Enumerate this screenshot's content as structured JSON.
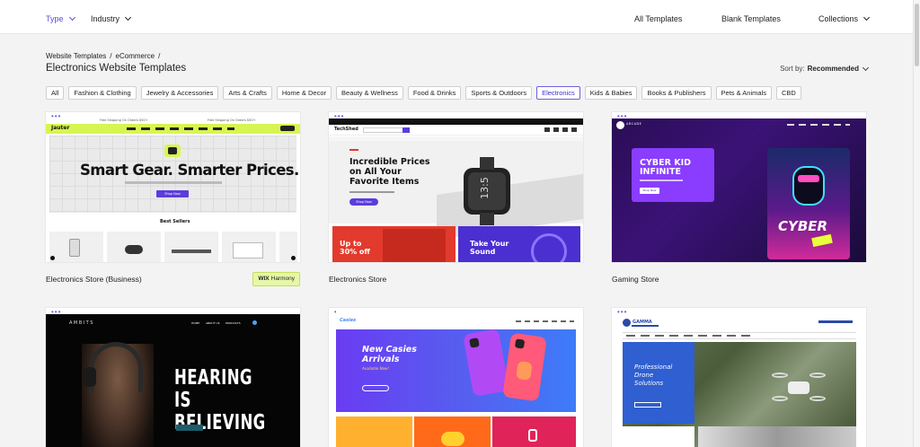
{
  "nav": {
    "type": "Type",
    "industry": "Industry",
    "all_templates": "All Templates",
    "blank_templates": "Blank Templates",
    "collections": "Collections"
  },
  "breadcrumb": [
    "Website Templates",
    "/",
    "eCommerce",
    "/"
  ],
  "page_title": "Electronics Website Templates",
  "sort": {
    "label": "Sort by:",
    "value": "Recommended"
  },
  "chips": [
    "All",
    "Fashion & Clothing",
    "Jewelry & Accessories",
    "Arts & Crafts",
    "Home & Decor",
    "Beauty & Wellness",
    "Food & Drinks",
    "Sports & Outdoors",
    "Electronics",
    "Kids & Babies",
    "Books & Publishers",
    "Pets & Animals",
    "CBD"
  ],
  "active_chip": "Electronics",
  "cards": [
    {
      "title": "Electronics Store (Business)",
      "badge_brand": "WIX",
      "badge_text": "Harmony",
      "preview": {
        "banner": "Free Shipping On Orders $50+",
        "logo": "Jauter",
        "headline": "Smart Gear. Smarter Prices.",
        "cta": "Shop Now",
        "section": "Best Sellers"
      }
    },
    {
      "title": "Electronics Store",
      "preview": {
        "logo": "TechShed",
        "headline_1": "Incredible Prices",
        "headline_2": "on All Your",
        "headline_3": "Favorite Items",
        "cta": "Shop Now",
        "promo_1a": "Up to",
        "promo_1b": "30% off",
        "promo_2a": "Take Your",
        "promo_2b": "Sound",
        "watch": "13:5"
      }
    },
    {
      "title": "Gaming Store",
      "preview": {
        "logo": "ARCADE",
        "headline_1": "CYBER KID",
        "headline_2": "INFINITE",
        "cta": "Shop Now",
        "art_text": "CYBER"
      }
    },
    {
      "title": "",
      "preview": {
        "logo": "AMBITS",
        "headline_1": "HEARING IS",
        "headline_2": "BELIEVING",
        "nav_1": "HOME",
        "nav_2": "ABOUT US",
        "nav_3": "PRODUCTS"
      }
    },
    {
      "title": "",
      "preview": {
        "logo": "Casies",
        "headline_1": "New Casies",
        "headline_2": "Arrivals",
        "sub": "Available Now!"
      }
    },
    {
      "title": "",
      "preview": {
        "logo": "GAMMA",
        "headline_1": "Professional",
        "headline_2": "Drone",
        "headline_3": "Solutions"
      }
    }
  ]
}
